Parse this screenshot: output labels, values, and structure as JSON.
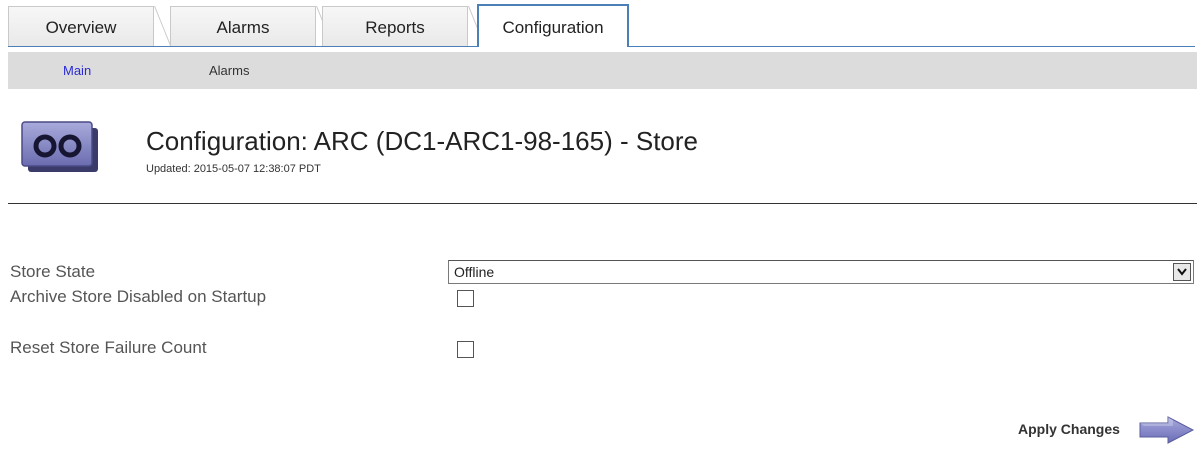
{
  "tabs": [
    {
      "label": "Overview",
      "active": false
    },
    {
      "label": "Alarms",
      "active": false
    },
    {
      "label": "Reports",
      "active": false
    },
    {
      "label": "Configuration",
      "active": true
    }
  ],
  "subnav": [
    {
      "label": "Main",
      "active": true
    },
    {
      "label": "Alarms",
      "active": false
    }
  ],
  "header": {
    "title": "Configuration: ARC (DC1-ARC1-98-165) - Store",
    "updated": "Updated: 2015-05-07 12:38:07 PDT",
    "icon": "archive-node-icon"
  },
  "form": {
    "store_state": {
      "label": "Store State",
      "value": "Offline"
    },
    "archive_store_disabled": {
      "label": "Archive Store Disabled on Startup",
      "checked": false
    },
    "reset_failure_count": {
      "label": "Reset Store Failure Count",
      "checked": false
    }
  },
  "actions": {
    "apply_label": "Apply Changes",
    "apply_icon": "arrow-right-icon"
  },
  "colors": {
    "active_tab_border": "#4a7fb8",
    "subnav_background": "#dcdcdc",
    "active_link": "#2b2bd6",
    "icon_fill": "#7d7fc0"
  }
}
